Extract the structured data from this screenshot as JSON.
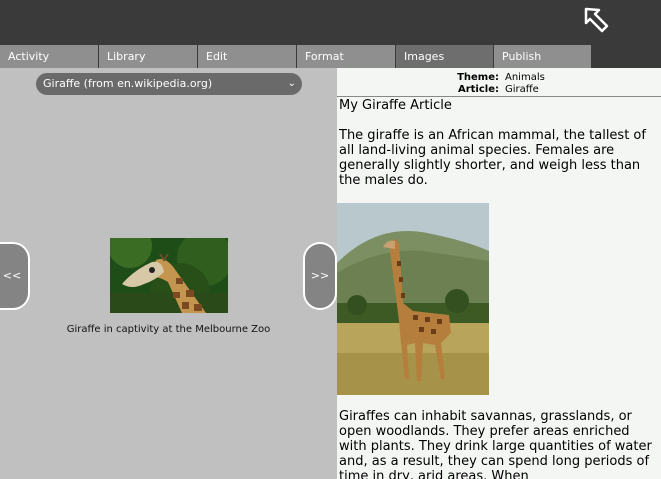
{
  "tabs": [
    {
      "label": "Activity"
    },
    {
      "label": "Library"
    },
    {
      "label": "Edit"
    },
    {
      "label": "Format"
    },
    {
      "label": "Images"
    },
    {
      "label": "Publish"
    }
  ],
  "active_tab": "Images",
  "source_select": {
    "value": "Giraffe (from en.wikipedia.org)"
  },
  "nav": {
    "prev_label": "<<",
    "next_label": ">>"
  },
  "image_caption": "Giraffe in captivity at the Melbourne Zoo",
  "header": {
    "theme_key": "Theme:",
    "theme_value": "Animals",
    "article_key": "Article:",
    "article_value": "Giraffe"
  },
  "article": {
    "title": "My Giraffe Article",
    "paragraph1": "The giraffe is an African mammal, the tallest of all land-living animal species. Females are generally slightly shorter, and weigh less than the males do.",
    "paragraph2": "Giraffes can inhabit savannas, grasslands, or open woodlands. They prefer areas enriched with plants. They drink large quantities of water and, as a result, they can spend long periods of time in dry, arid areas. When"
  }
}
